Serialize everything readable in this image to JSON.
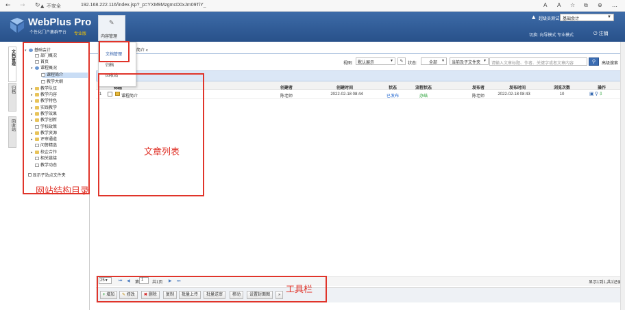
{
  "browser": {
    "url_warning": "不安全",
    "url": "192.168.222.116/index.jsp?_p=YXM9MzgmcD0xJm09TiY_",
    "icons": [
      "back-icon",
      "forward-icon",
      "refresh-icon",
      "warning-icon"
    ]
  },
  "header": {
    "logo_title": "WebPlus Pro",
    "logo_subtitle": "个性化门户集群平台",
    "edition": "专业版",
    "content_mgmt_label": "内容管理",
    "user_label": "超级员测试",
    "site_select_value": "基础会计",
    "mode_links": "切换: 向导模式  专业模式",
    "logout_label": "注销",
    "brand_color": "#2f5c98"
  },
  "side_tabs": [
    {
      "label": "文档管理"
    },
    {
      "label": "归档"
    },
    {
      "label": "回收站"
    }
  ],
  "dropdown": {
    "items": [
      "文档管理",
      "归档",
      "回收站"
    ]
  },
  "tab": {
    "label": "简介 «"
  },
  "tree": {
    "nodes": [
      {
        "label": "基础会计",
        "level": 0,
        "icon": "globe"
      },
      {
        "label": "部门概况",
        "level": 1,
        "icon": "page"
      },
      {
        "label": "首页",
        "level": 1,
        "icon": "page"
      },
      {
        "label": "课程概况",
        "level": 1,
        "icon": "globe"
      },
      {
        "label": "课程简介",
        "level": 2,
        "icon": "page"
      },
      {
        "label": "教学大纲",
        "level": 2,
        "icon": "page"
      },
      {
        "label": "教学队伍",
        "level": 1,
        "icon": "folder"
      },
      {
        "label": "教学内容",
        "level": 1,
        "icon": "folder"
      },
      {
        "label": "教学特色",
        "level": 1,
        "icon": "folder"
      },
      {
        "label": "实践教学",
        "level": 1,
        "icon": "folder"
      },
      {
        "label": "教学效果",
        "level": 1,
        "icon": "folder"
      },
      {
        "label": "教学创新",
        "level": 1,
        "icon": "folder"
      },
      {
        "label": "学校政策",
        "level": 1,
        "icon": "page"
      },
      {
        "label": "教学资源",
        "level": 1,
        "icon": "folder"
      },
      {
        "label": "评审通道",
        "level": 1,
        "icon": "folder"
      },
      {
        "label": "问答精选",
        "level": 1,
        "icon": "page"
      },
      {
        "label": "校企合作",
        "level": 1,
        "icon": "folder"
      },
      {
        "label": "相关链接",
        "level": 1,
        "icon": "page"
      },
      {
        "label": "教学动态",
        "level": 1,
        "icon": "page"
      }
    ],
    "show_subfolders": "显示子站点文件夹"
  },
  "filters": {
    "view_label": "视图:",
    "view_value": "默认展示",
    "status_label": "状态:",
    "status_value": "全部",
    "scope_value": "当前及子文件夹",
    "search_placeholder": "请输入文章标题、作者、关键字或者文章内容",
    "advanced_search": "高级搜索"
  },
  "table": {
    "headers": [
      "标题",
      "创建者",
      "创建时间",
      "状态",
      "流程状态",
      "发布者",
      "发布时间",
      "浏览次数",
      "操作"
    ],
    "rows": [
      {
        "index": "1",
        "title": "课程简介",
        "creator": "陈老师",
        "created": "2022-02-18 08:44",
        "status": "已发布",
        "flow": "办结",
        "publisher": "陈老师",
        "published": "2022-02-18 08:43",
        "views": "10"
      }
    ],
    "status_color": "#2a6cd0",
    "flow_color": "#1a9a2a"
  },
  "pager": {
    "page_size": "25",
    "page_label": "第",
    "page_value": "1",
    "total_pages": "共1页",
    "summary": "显示1到1,共1记录"
  },
  "toolbar": {
    "buttons": [
      "增加",
      "修改",
      "删除",
      "复制",
      "批量上传",
      "批量送审",
      "移动",
      "设置封面图",
      "»"
    ]
  },
  "annotations": {
    "tree_note": "网站结构目录",
    "list_note": "文章列表",
    "toolbar_note": "工具栏"
  }
}
